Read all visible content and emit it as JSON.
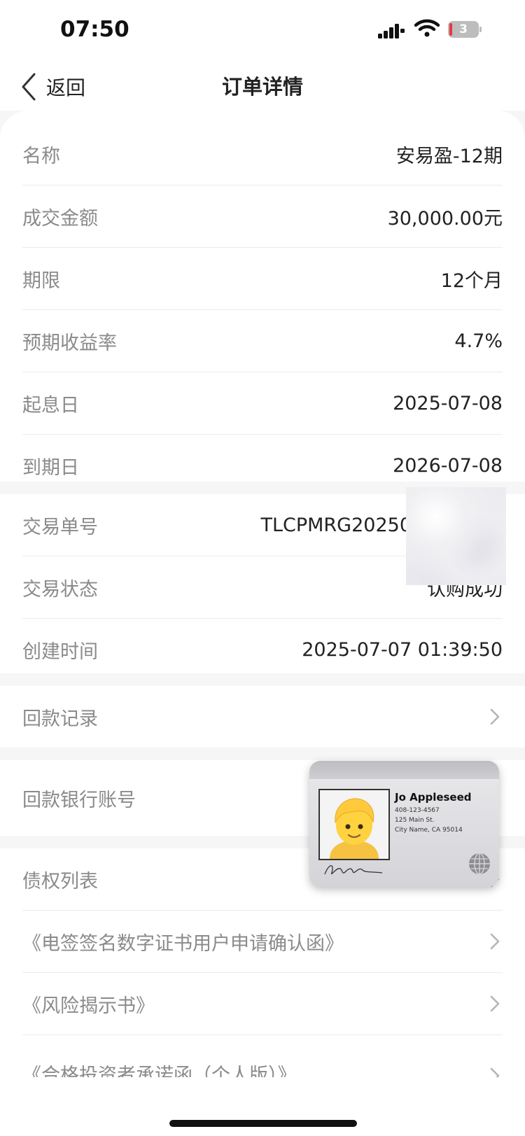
{
  "status_bar": {
    "time": "07:50",
    "battery": "3"
  },
  "nav": {
    "back_label": "返回",
    "title": "订单详情"
  },
  "product": {
    "rows": [
      {
        "label": "名称",
        "value": "安易盈-12期"
      },
      {
        "label": "成交金额",
        "value": "30,000.00元"
      },
      {
        "label": "期限",
        "value": "12个月"
      },
      {
        "label": "预期收益率",
        "value": "4.7%"
      },
      {
        "label": "起息日",
        "value": "2025-07-08"
      },
      {
        "label": "到期日",
        "value": "2026-07-08"
      }
    ]
  },
  "transaction": {
    "rows": [
      {
        "label": "交易单号",
        "value": "TLCPMRG20250"
      },
      {
        "label": "交易状态",
        "value": "认购成功"
      },
      {
        "label": "创建时间",
        "value": "2025-07-07 01:39:50"
      }
    ]
  },
  "links": {
    "repayment_record": "回款记录",
    "repayment_account": "回款银行账号",
    "claims_list": "债权列表",
    "doc_certificate": "《电签签名数字证书用户申请确认函》",
    "doc_risk": "《风险揭示书》",
    "doc_investor": "《合格投资者承诺函（个人版）》"
  },
  "contact_card": {
    "name": "Jo Appleseed",
    "phone": "408-123-4567",
    "street": "125 Main St.",
    "city": "City Name, CA 95014"
  }
}
